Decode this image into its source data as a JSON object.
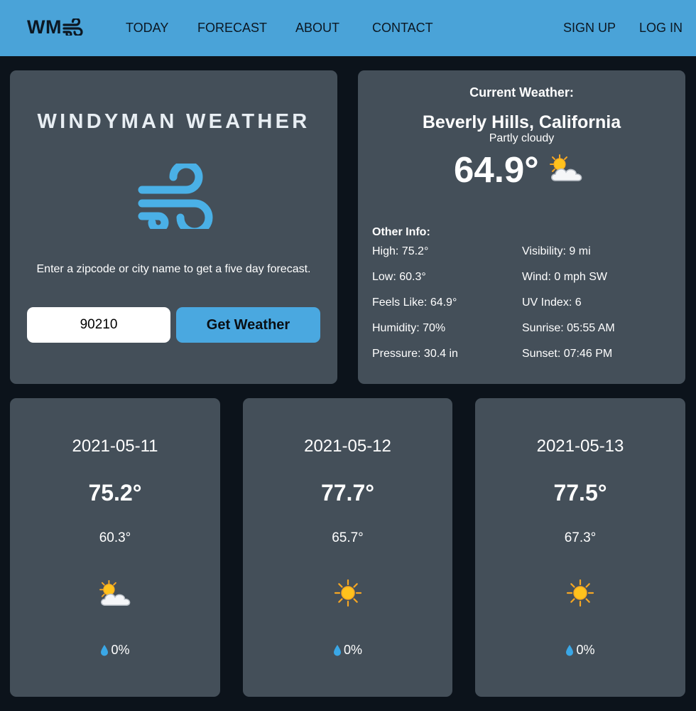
{
  "colors": {
    "header_bg": "#4aa3d8",
    "page_bg": "#0c131b",
    "panel_bg": "#444f59",
    "accent": "#4aa8e0"
  },
  "header": {
    "logo_text": "WM",
    "logo_icon": "wind-icon",
    "nav": [
      "TODAY",
      "FORECAST",
      "ABOUT",
      "CONTACT"
    ],
    "sign_up": "SIGN UP",
    "log_in": "LOG IN"
  },
  "hero": {
    "title": "WINDYMAN WEATHER",
    "icon": "wind-icon",
    "description": "Enter a zipcode or city name to get a five day forecast.",
    "zip_value": "90210",
    "button_label": "Get Weather"
  },
  "current": {
    "heading": "Current Weather:",
    "location": "Beverly Hills, California",
    "condition": "Partly cloudy",
    "temperature": "64.9°",
    "icon": "partly-cloudy-icon",
    "other_heading": "Other Info:",
    "info_left": [
      "High: 75.2°",
      "Low: 60.3°",
      "Feels Like: 64.9°",
      "Humidity: 70%",
      "Pressure: 30.4 in"
    ],
    "info_right": [
      "Visibility: 9 mi",
      "Wind: 0 mph SW",
      "UV Index: 6",
      "Sunrise: 05:55 AM",
      "Sunset: 07:46 PM"
    ]
  },
  "forecast": [
    {
      "date": "2021-05-11",
      "high": "75.2°",
      "low": "60.3°",
      "icon": "partly-cloudy-icon",
      "precip": "0%"
    },
    {
      "date": "2021-05-12",
      "high": "77.7°",
      "low": "65.7°",
      "icon": "sun-icon",
      "precip": "0%"
    },
    {
      "date": "2021-05-13",
      "high": "77.5°",
      "low": "67.3°",
      "icon": "sun-icon",
      "precip": "0%"
    }
  ]
}
